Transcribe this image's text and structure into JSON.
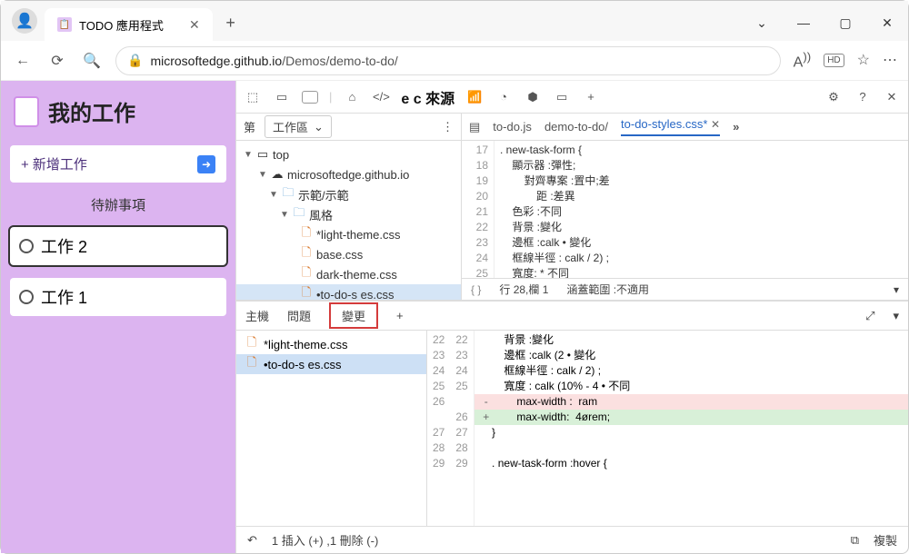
{
  "tab": {
    "title": "TODO 應用程式"
  },
  "url": {
    "host": "microsoftedge.github.io",
    "path": "/Demos/demo-to-do/"
  },
  "page": {
    "title": "我的工作",
    "add": "+ 新增工作",
    "section": "待辦事項",
    "tasks": [
      "工作 2",
      "工作 1"
    ]
  },
  "devtools": {
    "sources_label": "e c 來源",
    "nav_first": "第",
    "nav_dd": "工作區",
    "tree": {
      "top": "top",
      "host": "microsoftedge.github.io",
      "folder1": "示範/示範",
      "folder2": "風格",
      "files": [
        "*light-theme.css",
        "base.css",
        "dark-theme.css",
        "•to-do-s es.css",
        "demo-to-do/"
      ]
    },
    "editor_tabs": {
      "a": "to-do.js",
      "b": "demo-to-do/",
      "c": "to-do-styles.css*"
    },
    "code": {
      "lines": [
        ". new-task-form {",
        "    顯示器 :彈性;",
        "        對齊專案 :置中;差",
        "            距 :差異",
        "    色彩 :不同",
        "    背景 :變化",
        "    邊框 :calk • 變化",
        "    框線半徑 : calk / 2) ;",
        "    寬度: * 不同",
        "    max-width:  4ørem;",
        "}"
      ],
      "start": 17
    },
    "status": {
      "braces": "{ }",
      "pos": "行 28,欄 1",
      "cov": "涵蓋範圍 :不適用"
    }
  },
  "drawer": {
    "tabs": {
      "a": "主機",
      "b": "問題",
      "c": "變更"
    },
    "files": [
      "*light-theme.css",
      "•to-do-s es.css"
    ],
    "diff": {
      "left": [
        "22",
        "23",
        "24",
        "25",
        "26",
        "",
        "27",
        "28",
        "29"
      ],
      "right": [
        "22",
        "23",
        "24",
        "25",
        "",
        "26",
        "27",
        "28",
        "29"
      ],
      "lines": [
        {
          "t": "        背景 :變化"
        },
        {
          "t": "        邊框 :calk (2 • 變化"
        },
        {
          "t": "        框線半徑 : calk / 2) ;"
        },
        {
          "t": "        寬度 : calk (10% - 4 • 不同"
        },
        {
          "t": "        max-width :  ram",
          "k": "del"
        },
        {
          "t": "        max-width:  4ørem;",
          "k": "add"
        },
        {
          "t": "    }"
        },
        {
          "t": ""
        },
        {
          "t": "    . new-task-form :hover {"
        }
      ]
    },
    "foot": {
      "undo": "↶",
      "summary": "1 插入 (+) ,1 刪除 (-)",
      "copy": "複製"
    }
  }
}
